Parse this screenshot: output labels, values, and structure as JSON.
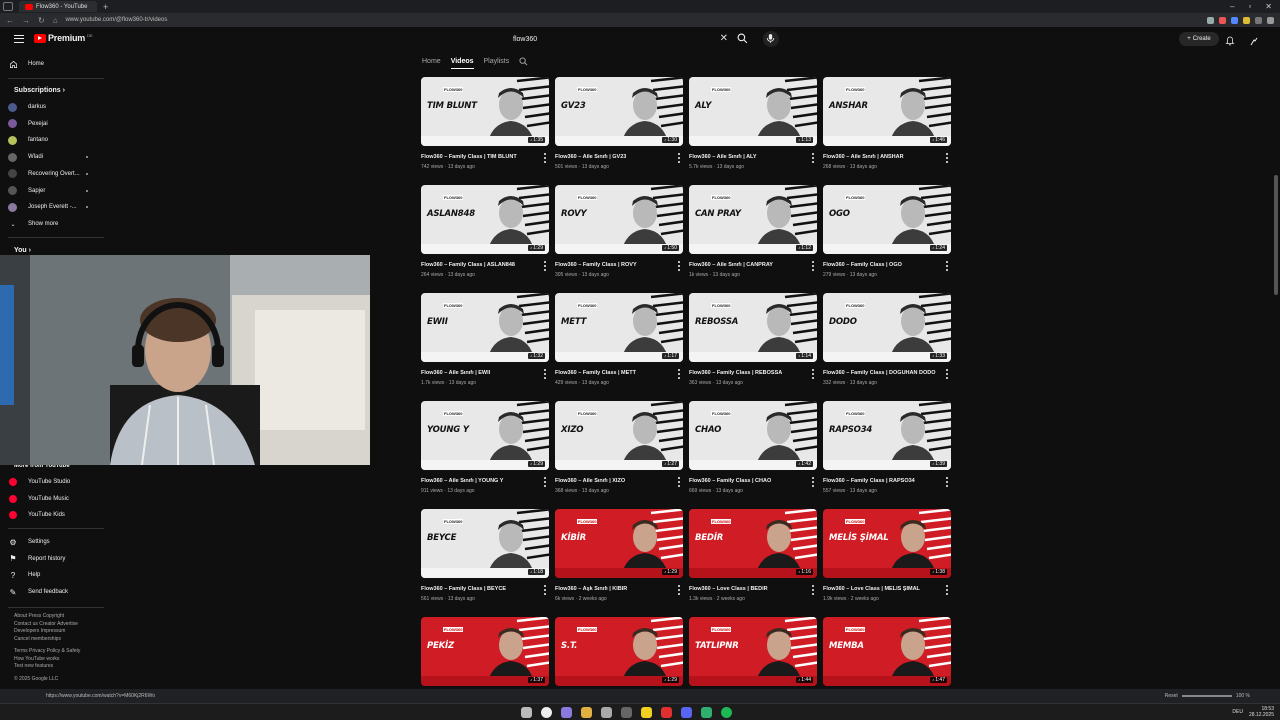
{
  "browser": {
    "tab_title": "Flow360 - YouTube",
    "new_tab": "+",
    "url": "www.youtube.com/@flow360-tr/videos",
    "status_link": "https://www.youtube.com/watch?v=M60Kj2R6Wo",
    "reset_label": "Reset",
    "zoom": "100 %"
  },
  "header": {
    "logo": "Premium",
    "logo_region": "DE",
    "search_query": "flow360",
    "create_label": "Create"
  },
  "sidebar": {
    "home": "Home",
    "subscriptions_heading": "Subscriptions",
    "subscriptions": [
      {
        "label": "darkus",
        "color": "#4a5a8a"
      },
      {
        "label": "Pexejai",
        "color": "#7a5a9a"
      },
      {
        "label": "fantano",
        "color": "#b5c25a"
      },
      {
        "label": "Wladi",
        "color": "#666666"
      },
      {
        "label": "Recovering Overt...",
        "color": "#444444"
      },
      {
        "label": "Sapjer",
        "color": "#555555"
      },
      {
        "label": "Joseph Everett -...",
        "color": "#8a7aa0"
      }
    ],
    "show_more": "Show more",
    "you_heading": "You",
    "more_heading": "More from YouTube",
    "more_items": [
      "YouTube Studio",
      "YouTube Music",
      "YouTube Kids"
    ],
    "settings_items": [
      "Settings",
      "Report history",
      "Help",
      "Send feedback"
    ],
    "footer_lines": [
      "About  Press  Copyright",
      "Contact us  Creator  Advertise",
      "Developers  Impressum",
      "Cancel memberships",
      "",
      "Terms  Privacy  Policy & Safety",
      "How YouTube works",
      "Test new features",
      "",
      "© 2025 Google LLC"
    ]
  },
  "channel_nav": {
    "tabs": [
      "Home",
      "Videos",
      "Playlists"
    ],
    "active": "Videos"
  },
  "videos": [
    {
      "thumb_name": "TIM BLUNT",
      "duration": "1:35",
      "title": "Flow360 – Family Class | TIM BLUNT",
      "views": "742 views",
      "age": "13 days ago",
      "style": "white"
    },
    {
      "thumb_name": "GV23",
      "duration": "1:30",
      "title": "Flow360 – Aile Sınıfı | GV23",
      "views": "501 views",
      "age": "13 days ago",
      "style": "white"
    },
    {
      "thumb_name": "ALY",
      "duration": "1:13",
      "title": "Flow360 – Aile Sınıfı | ALY",
      "views": "5.7k views",
      "age": "13 days ago",
      "style": "white"
    },
    {
      "thumb_name": "ANSHAR",
      "duration": "1:46",
      "title": "Flow360 – Aile Sınıfı | ANSHAR",
      "views": "268 views",
      "age": "13 days ago",
      "style": "white"
    },
    {
      "thumb_name": "ASLAN848",
      "duration": "1:29",
      "title": "Flow360 – Family Class | ASLAN848",
      "views": "264 views",
      "age": "13 days ago",
      "style": "white"
    },
    {
      "thumb_name": "ROVY",
      "duration": "1:50",
      "title": "Flow360 – Family Class | ROVY",
      "views": "305 views",
      "age": "13 days ago",
      "style": "white"
    },
    {
      "thumb_name": "CAN PRAY",
      "duration": "1:12",
      "title": "Flow360 – Aile Sınıfı | CANPRAY",
      "views": "1k views",
      "age": "13 days ago",
      "style": "white"
    },
    {
      "thumb_name": "OGO",
      "duration": "1:24",
      "title": "Flow360 – Family Class | OGO",
      "views": "279 views",
      "age": "13 days ago",
      "style": "white"
    },
    {
      "thumb_name": "EWII",
      "duration": "1:32",
      "title": "Flow360 – Aile Sınıfı | EWII",
      "views": "1.7k views",
      "age": "13 days ago",
      "style": "white"
    },
    {
      "thumb_name": "METT",
      "duration": "1:17",
      "title": "Flow360 – Family Class | METT",
      "views": "429 views",
      "age": "13 days ago",
      "style": "white"
    },
    {
      "thumb_name": "REBOSSA",
      "duration": "1:14",
      "title": "Flow360 – Family Class | REBOSSA",
      "views": "363 views",
      "age": "13 days ago",
      "style": "white"
    },
    {
      "thumb_name": "DODO",
      "duration": "1:33",
      "title": "Flow360 – Family Class | DOGUHAN DODO",
      "views": "332 views",
      "age": "13 days ago",
      "style": "white"
    },
    {
      "thumb_name": "YOUNG Y",
      "duration": "1:29",
      "title": "Flow360 – Aile Sınıfı | YOUNG Y",
      "views": "911 views",
      "age": "13 days ago",
      "style": "white"
    },
    {
      "thumb_name": "XIZO",
      "duration": "1:27",
      "title": "Flow360 – Aile Sınıfı | XIZO",
      "views": "368 views",
      "age": "13 days ago",
      "style": "white"
    },
    {
      "thumb_name": "CHAO",
      "duration": "1:42",
      "title": "Flow360 – Family Class | CHAO",
      "views": "669 views",
      "age": "13 days ago",
      "style": "white"
    },
    {
      "thumb_name": "RAPSO34",
      "duration": "1:39",
      "title": "Flow360 – Family Class | RAPSO34",
      "views": "557 views",
      "age": "13 days ago",
      "style": "white"
    },
    {
      "thumb_name": "BEYCE",
      "duration": "1:18",
      "title": "Flow360 – Family Class | BEYCE",
      "views": "561 views",
      "age": "13 days ago",
      "style": "white"
    },
    {
      "thumb_name": "KİBİR",
      "duration": "1:29",
      "title": "Flow360 – Aşk Sınıfı | KİBİR",
      "views": "6k views",
      "age": "2 weeks ago",
      "style": "red"
    },
    {
      "thumb_name": "BEDİR",
      "duration": "1:16",
      "title": "Flow360 – Love Class | BEDIR",
      "views": "1.3k views",
      "age": "2 weeks ago",
      "style": "red"
    },
    {
      "thumb_name": "MELİS ŞİMAL",
      "duration": "1:38",
      "title": "Flow360 – Love Class | MELIS ŞİMAL",
      "views": "1.9k views",
      "age": "2 weeks ago",
      "style": "red"
    },
    {
      "thumb_name": "PEKİZ",
      "duration": "1:37",
      "title": "",
      "views": "",
      "age": "",
      "style": "red"
    },
    {
      "thumb_name": "S.T.",
      "duration": "1:29",
      "title": "",
      "views": "",
      "age": "",
      "style": "red"
    },
    {
      "thumb_name": "TATLIPNR",
      "duration": "1:44",
      "title": "",
      "views": "",
      "age": "",
      "style": "red"
    },
    {
      "thumb_name": "MEMBA",
      "duration": "1:47",
      "title": "",
      "views": "",
      "age": "",
      "style": "red"
    }
  ],
  "taskbar": {
    "lang": "DEU",
    "time": "18:53",
    "date": "28.12.2025"
  }
}
